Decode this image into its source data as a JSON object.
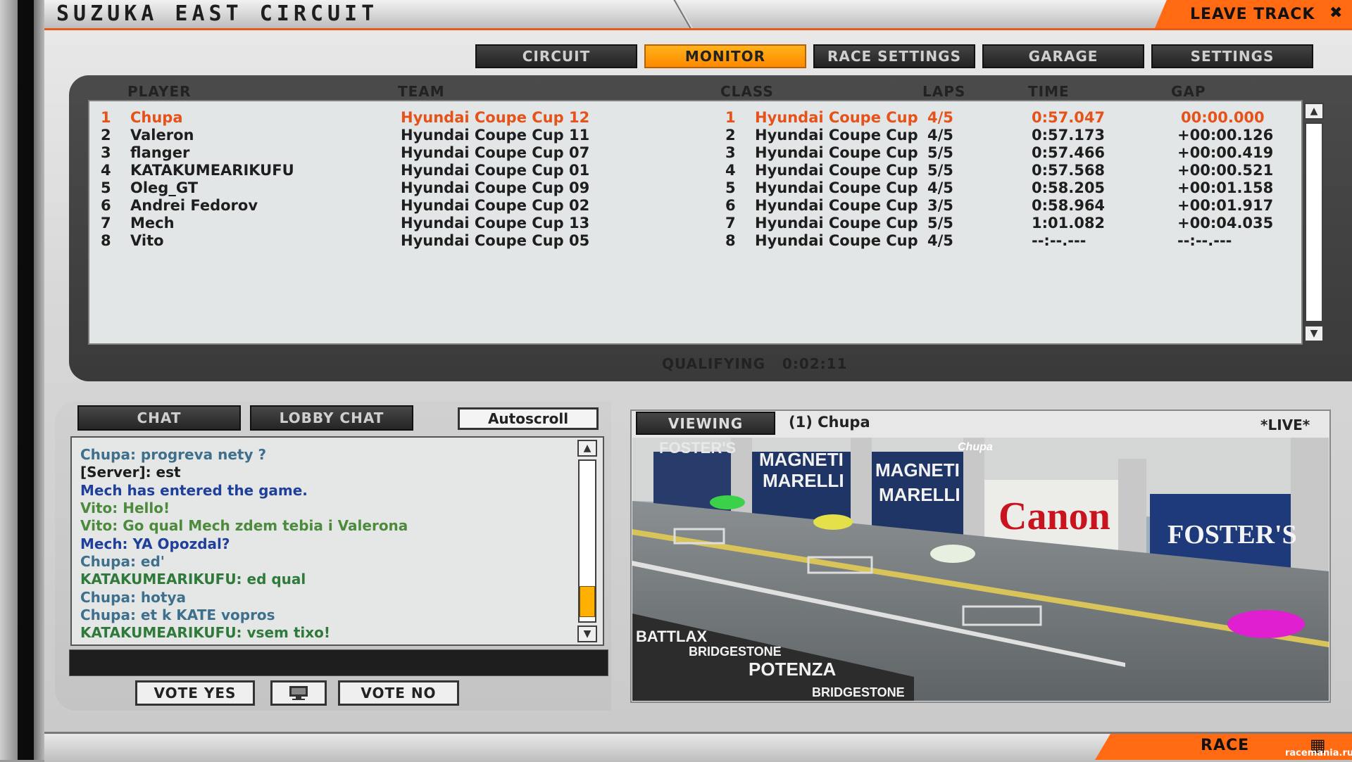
{
  "header": {
    "title": "SUZUKA EAST CIRCUIT",
    "leave_label": "LEAVE TRACK"
  },
  "tabs": [
    {
      "label": "CIRCUIT",
      "active": false
    },
    {
      "label": "MONITOR",
      "active": true
    },
    {
      "label": "RACE SETTINGS",
      "active": false
    },
    {
      "label": "GARAGE",
      "active": false
    },
    {
      "label": "SETTINGS",
      "active": false
    }
  ],
  "results": {
    "columns": {
      "player": "PLAYER",
      "team": "TEAM",
      "class": "CLASS",
      "laps": "LAPS",
      "time": "TIME",
      "gap": "GAP"
    },
    "rows": [
      {
        "pos": "1",
        "player": "Chupa",
        "team": "Hyundai Coupe Cup 12",
        "class_pos": "1",
        "class": "Hyundai Coupe Cup",
        "laps": "4/5",
        "time": "0:57.047",
        "gap": "00:00.000"
      },
      {
        "pos": "2",
        "player": "Valeron",
        "team": "Hyundai Coupe Cup 11",
        "class_pos": "2",
        "class": "Hyundai Coupe Cup",
        "laps": "4/5",
        "time": "0:57.173",
        "gap": "+00:00.126"
      },
      {
        "pos": "3",
        "player": "flanger",
        "team": "Hyundai Coupe Cup 07",
        "class_pos": "3",
        "class": "Hyundai Coupe Cup",
        "laps": "5/5",
        "time": "0:57.466",
        "gap": "+00:00.419"
      },
      {
        "pos": "4",
        "player": "KATAKUMEARIKUFU",
        "team": "Hyundai Coupe Cup 01",
        "class_pos": "4",
        "class": "Hyundai Coupe Cup",
        "laps": "5/5",
        "time": "0:57.568",
        "gap": "+00:00.521"
      },
      {
        "pos": "5",
        "player": "Oleg_GT",
        "team": "Hyundai Coupe Cup 09",
        "class_pos": "5",
        "class": "Hyundai Coupe Cup",
        "laps": "4/5",
        "time": "0:58.205",
        "gap": "+00:01.158"
      },
      {
        "pos": "6",
        "player": "Andrei Fedorov",
        "team": "Hyundai Coupe Cup 02",
        "class_pos": "6",
        "class": "Hyundai Coupe Cup",
        "laps": "3/5",
        "time": "0:58.964",
        "gap": "+00:01.917"
      },
      {
        "pos": "7",
        "player": "Mech",
        "team": "Hyundai Coupe Cup 13",
        "class_pos": "7",
        "class": "Hyundai Coupe Cup",
        "laps": "5/5",
        "time": "1:01.082",
        "gap": "+00:04.035"
      },
      {
        "pos": "8",
        "player": "Vito",
        "team": "Hyundai Coupe Cup 05",
        "class_pos": "8",
        "class": "Hyundai Coupe Cup",
        "laps": "4/5",
        "time": "--:--.---",
        "gap": "--:--.---"
      }
    ],
    "session_label": "QUALIFYING",
    "session_time": "0:02:11"
  },
  "chat": {
    "tab_chat": "CHAT",
    "tab_lobby": "LOBBY CHAT",
    "autoscroll_label": "Autoscroll",
    "lines": [
      {
        "text": "Chupa: progreva nety ?",
        "color": "#3e6f8c"
      },
      {
        "text": "[Server]: est",
        "color": "#1c1c1c"
      },
      {
        "text": "Mech has entered the game.",
        "color": "#1f3f9a"
      },
      {
        "text": "Vito: Hello!",
        "color": "#4c8a3c"
      },
      {
        "text": "Vito: Go qual Mech zdem tebia i Valerona",
        "color": "#4c8a3c"
      },
      {
        "text": "Mech: YA Opozdal?",
        "color": "#1f3f9a"
      },
      {
        "text": "Chupa: ed'",
        "color": "#3e6f8c"
      },
      {
        "text": "KATAKUMEARIKUFU: ed qual",
        "color": "#2f7a3a"
      },
      {
        "text": "Chupa: hotya",
        "color": "#3e6f8c"
      },
      {
        "text": "Chupa: et k KATE vopros",
        "color": "#3e6f8c"
      },
      {
        "text": "KATAKUMEARIKUFU: vsem tixo!",
        "color": "#2f7a3a"
      }
    ],
    "vote_yes": "VOTE YES",
    "vote_no": "VOTE NO"
  },
  "viewer": {
    "viewing_label": "VIEWING",
    "viewing_target": "(1) Chupa",
    "live_label": "*LIVE*",
    "car_label": "Chupa",
    "billboards": {
      "fosters_small": "FOSTER'S",
      "magneti1": "MAGNETI",
      "marelli1": "MARELLI",
      "magneti2": "MAGNETI",
      "marelli2": "MARELLI",
      "canon": "Canon",
      "fosters_big": "FOSTER'S",
      "battlax": "BATTLAX",
      "bridgestone1": "BRIDGESTONE",
      "potenza": "POTENZA",
      "bridgestone2": "BRIDGESTONE"
    }
  },
  "footer": {
    "race_label": "RACE",
    "watermark": "racemania.ru"
  },
  "colors": {
    "accent": "#ff6a12",
    "leader": "#e5521a",
    "active_tab": "#ffa010"
  }
}
